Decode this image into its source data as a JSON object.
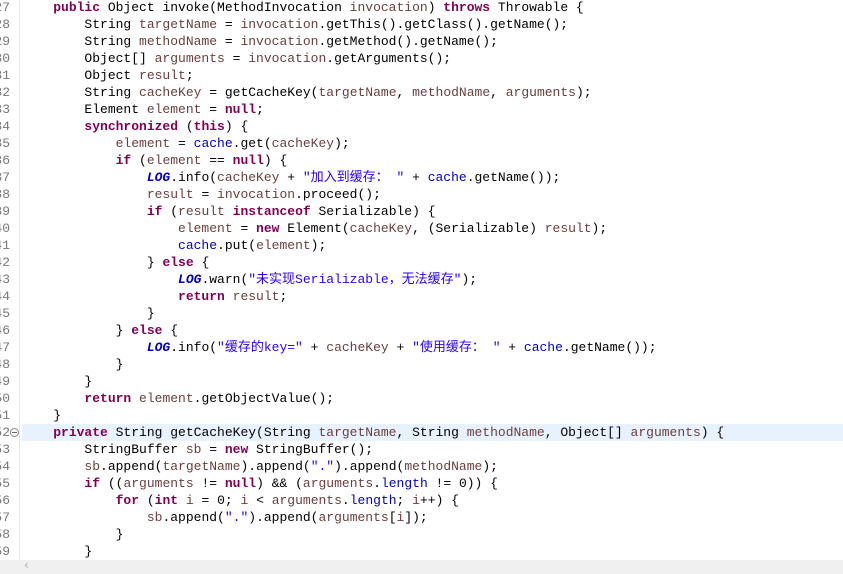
{
  "editor": {
    "first_line_number": 27,
    "current_line": 52,
    "fold_line": 52,
    "colors": {
      "keyword": "#7f0055",
      "field": "#0000c0",
      "string": "#2a00ff",
      "variable": "#6a3e3e",
      "current_line_bg": "#e8f2fe"
    },
    "lines": [
      [
        [
          "p",
          "    "
        ],
        [
          "k",
          "public"
        ],
        [
          "p",
          " Object invoke(MethodInvocation "
        ],
        [
          "v",
          "invocation"
        ],
        [
          "p",
          ") "
        ],
        [
          "k",
          "throws"
        ],
        [
          "p",
          " Throwable {"
        ]
      ],
      [
        [
          "p",
          "        String "
        ],
        [
          "v",
          "targetName"
        ],
        [
          "p",
          " = "
        ],
        [
          "v",
          "invocation"
        ],
        [
          "p",
          ".getThis().getClass().getName();"
        ]
      ],
      [
        [
          "p",
          "        String "
        ],
        [
          "v",
          "methodName"
        ],
        [
          "p",
          " = "
        ],
        [
          "v",
          "invocation"
        ],
        [
          "p",
          ".getMethod().getName();"
        ]
      ],
      [
        [
          "p",
          "        Object[] "
        ],
        [
          "v",
          "arguments"
        ],
        [
          "p",
          " = "
        ],
        [
          "v",
          "invocation"
        ],
        [
          "p",
          ".getArguments();"
        ]
      ],
      [
        [
          "p",
          "        Object "
        ],
        [
          "v",
          "result"
        ],
        [
          "p",
          ";"
        ]
      ],
      [
        [
          "p",
          "        String "
        ],
        [
          "v",
          "cacheKey"
        ],
        [
          "p",
          " = getCacheKey("
        ],
        [
          "v",
          "targetName"
        ],
        [
          "p",
          ", "
        ],
        [
          "v",
          "methodName"
        ],
        [
          "p",
          ", "
        ],
        [
          "v",
          "arguments"
        ],
        [
          "p",
          ");"
        ]
      ],
      [
        [
          "p",
          "        Element "
        ],
        [
          "v",
          "element"
        ],
        [
          "p",
          " = "
        ],
        [
          "k",
          "null"
        ],
        [
          "p",
          ";"
        ]
      ],
      [
        [
          "p",
          "        "
        ],
        [
          "k",
          "synchronized"
        ],
        [
          "p",
          " ("
        ],
        [
          "k",
          "this"
        ],
        [
          "p",
          ") {"
        ]
      ],
      [
        [
          "p",
          "            "
        ],
        [
          "v",
          "element"
        ],
        [
          "p",
          " = "
        ],
        [
          "f",
          "cache"
        ],
        [
          "p",
          ".get("
        ],
        [
          "v",
          "cacheKey"
        ],
        [
          "p",
          ");"
        ]
      ],
      [
        [
          "p",
          "            "
        ],
        [
          "k",
          "if"
        ],
        [
          "p",
          " ("
        ],
        [
          "v",
          "element"
        ],
        [
          "p",
          " == "
        ],
        [
          "k",
          "null"
        ],
        [
          "p",
          ") {"
        ]
      ],
      [
        [
          "p",
          "                "
        ],
        [
          "L",
          "LOG"
        ],
        [
          "p",
          ".info("
        ],
        [
          "v",
          "cacheKey"
        ],
        [
          "p",
          " + "
        ],
        [
          "s",
          "\"加入到缓存： \""
        ],
        [
          "p",
          " + "
        ],
        [
          "f",
          "cache"
        ],
        [
          "p",
          ".getName());"
        ]
      ],
      [
        [
          "p",
          "                "
        ],
        [
          "v",
          "result"
        ],
        [
          "p",
          " = "
        ],
        [
          "v",
          "invocation"
        ],
        [
          "p",
          ".proceed();"
        ]
      ],
      [
        [
          "p",
          "                "
        ],
        [
          "k",
          "if"
        ],
        [
          "p",
          " ("
        ],
        [
          "v",
          "result"
        ],
        [
          "p",
          " "
        ],
        [
          "k",
          "instanceof"
        ],
        [
          "p",
          " Serializable) {"
        ]
      ],
      [
        [
          "p",
          "                    "
        ],
        [
          "v",
          "element"
        ],
        [
          "p",
          " = "
        ],
        [
          "k",
          "new"
        ],
        [
          "p",
          " Element("
        ],
        [
          "v",
          "cacheKey"
        ],
        [
          "p",
          ", (Serializable) "
        ],
        [
          "v",
          "result"
        ],
        [
          "p",
          ");"
        ]
      ],
      [
        [
          "p",
          "                    "
        ],
        [
          "f",
          "cache"
        ],
        [
          "p",
          ".put("
        ],
        [
          "v",
          "element"
        ],
        [
          "p",
          ");"
        ]
      ],
      [
        [
          "p",
          "                } "
        ],
        [
          "k",
          "else"
        ],
        [
          "p",
          " {"
        ]
      ],
      [
        [
          "p",
          "                    "
        ],
        [
          "L",
          "LOG"
        ],
        [
          "p",
          ".warn("
        ],
        [
          "s",
          "\"未实现Serializable，无法缓存\""
        ],
        [
          "p",
          ");"
        ]
      ],
      [
        [
          "p",
          "                    "
        ],
        [
          "k",
          "return"
        ],
        [
          "p",
          " "
        ],
        [
          "v",
          "result"
        ],
        [
          "p",
          ";"
        ]
      ],
      [
        [
          "p",
          "                }"
        ]
      ],
      [
        [
          "p",
          "            } "
        ],
        [
          "k",
          "else"
        ],
        [
          "p",
          " {"
        ]
      ],
      [
        [
          "p",
          "                "
        ],
        [
          "L",
          "LOG"
        ],
        [
          "p",
          ".info("
        ],
        [
          "s",
          "\"缓存的key=\""
        ],
        [
          "p",
          " + "
        ],
        [
          "v",
          "cacheKey"
        ],
        [
          "p",
          " + "
        ],
        [
          "s",
          "\"使用缓存： \""
        ],
        [
          "p",
          " + "
        ],
        [
          "f",
          "cache"
        ],
        [
          "p",
          ".getName());"
        ]
      ],
      [
        [
          "p",
          "            }"
        ]
      ],
      [
        [
          "p",
          "        }"
        ]
      ],
      [
        [
          "p",
          "        "
        ],
        [
          "k",
          "return"
        ],
        [
          "p",
          " "
        ],
        [
          "v",
          "element"
        ],
        [
          "p",
          ".getObjectValue();"
        ]
      ],
      [
        [
          "p",
          "    }"
        ]
      ],
      [
        [
          "p",
          "    "
        ],
        [
          "k",
          "private"
        ],
        [
          "p",
          " String getCacheKey(String "
        ],
        [
          "v",
          "targetName"
        ],
        [
          "p",
          ", String "
        ],
        [
          "v",
          "methodName"
        ],
        [
          "p",
          ", Object[] "
        ],
        [
          "v",
          "arguments"
        ],
        [
          "p",
          ") {"
        ]
      ],
      [
        [
          "p",
          "        StringBuffer "
        ],
        [
          "v",
          "sb"
        ],
        [
          "p",
          " = "
        ],
        [
          "k",
          "new"
        ],
        [
          "p",
          " StringBuffer();"
        ]
      ],
      [
        [
          "p",
          "        "
        ],
        [
          "v",
          "sb"
        ],
        [
          "p",
          ".append("
        ],
        [
          "v",
          "targetName"
        ],
        [
          "p",
          ").append("
        ],
        [
          "s",
          "\".\""
        ],
        [
          "p",
          ").append("
        ],
        [
          "v",
          "methodName"
        ],
        [
          "p",
          ");"
        ]
      ],
      [
        [
          "p",
          "        "
        ],
        [
          "k",
          "if"
        ],
        [
          "p",
          " (("
        ],
        [
          "v",
          "arguments"
        ],
        [
          "p",
          " != "
        ],
        [
          "k",
          "null"
        ],
        [
          "p",
          ") && ("
        ],
        [
          "v",
          "arguments"
        ],
        [
          "p",
          "."
        ],
        [
          "f",
          "length"
        ],
        [
          "p",
          " != 0)) {"
        ]
      ],
      [
        [
          "p",
          "            "
        ],
        [
          "k",
          "for"
        ],
        [
          "p",
          " ("
        ],
        [
          "k",
          "int"
        ],
        [
          "p",
          " "
        ],
        [
          "v",
          "i"
        ],
        [
          "p",
          " = 0; "
        ],
        [
          "v",
          "i"
        ],
        [
          "p",
          " < "
        ],
        [
          "v",
          "arguments"
        ],
        [
          "p",
          "."
        ],
        [
          "f",
          "length"
        ],
        [
          "p",
          "; "
        ],
        [
          "v",
          "i"
        ],
        [
          "p",
          "++) {"
        ]
      ],
      [
        [
          "p",
          "                "
        ],
        [
          "v",
          "sb"
        ],
        [
          "p",
          ".append("
        ],
        [
          "s",
          "\".\""
        ],
        [
          "p",
          ").append("
        ],
        [
          "v",
          "arguments"
        ],
        [
          "p",
          "["
        ],
        [
          "v",
          "i"
        ],
        [
          "p",
          "]);"
        ]
      ],
      [
        [
          "p",
          "            }"
        ]
      ],
      [
        [
          "p",
          "        }"
        ]
      ]
    ]
  },
  "scrollbar": {
    "left_arrow_icon": "chevron-left-icon",
    "left_arrow_glyph": "‹"
  }
}
